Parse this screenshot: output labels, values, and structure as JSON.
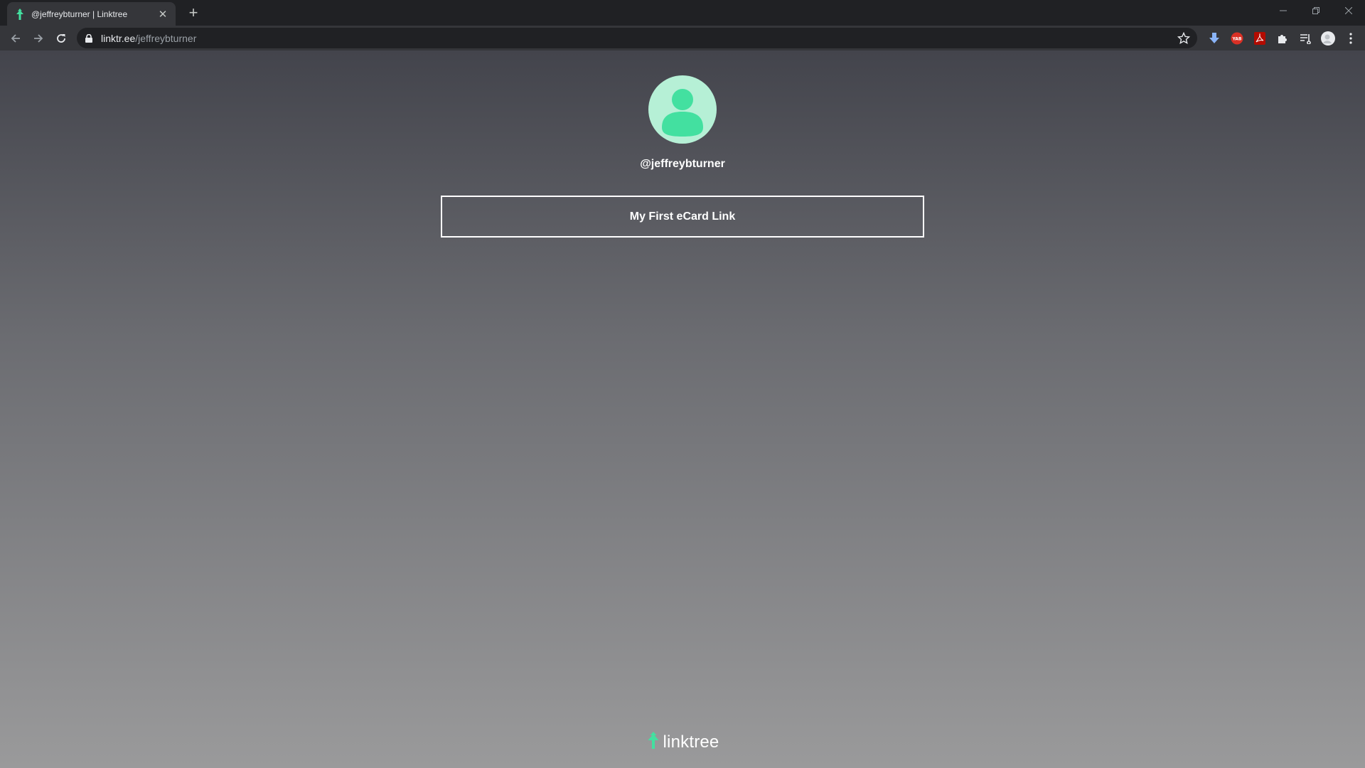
{
  "browser": {
    "tab_title": "@jeffreybturner | Linktree",
    "url_host": "linktr.ee",
    "url_path": "/jeffreybturner",
    "new_tab_symbol": "+",
    "close_symbol": "✕",
    "extensions": [
      "download-icon",
      "yab-extension-icon",
      "pdf-extension-icon",
      "puzzle-extensions-icon",
      "reading-list-icon",
      "profile-avatar",
      "menu-dots-icon"
    ],
    "yab_label": "YAB"
  },
  "profile": {
    "username": "@jeffreybturner",
    "avatar_color": "#b6f0d6",
    "avatar_figure_color": "#43e0a0"
  },
  "links": [
    {
      "label": "My First eCard Link"
    }
  ],
  "footer": {
    "brand": "linktree",
    "accent": "#43e0a0"
  }
}
